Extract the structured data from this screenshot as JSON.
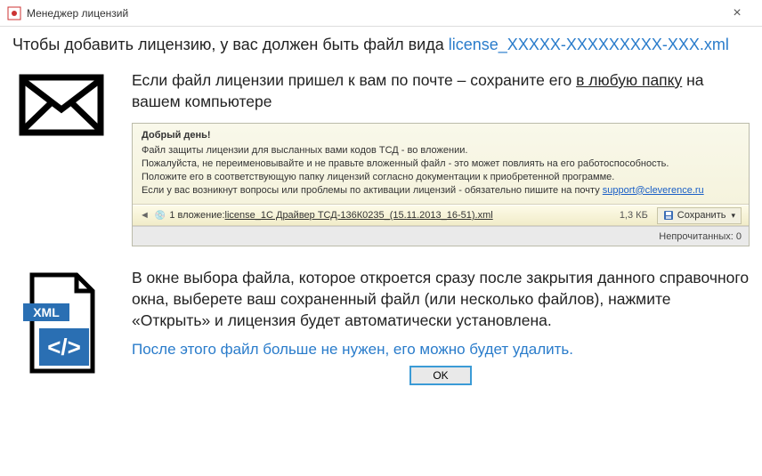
{
  "window": {
    "title": "Менеджер лицензий"
  },
  "header": {
    "prefix": "Чтобы добавить лицензию, у вас должен быть файл вида ",
    "filename": "license_XXXXX-XXXXXXXXX-XXX.xml"
  },
  "section1": {
    "line_pre": "Если файл лицензии пришел к вам по почте – сохраните его ",
    "link": "в любую папку",
    "line_post": " на вашем компьютере"
  },
  "email": {
    "greet": "Добрый день!",
    "l1": "Файл защиты лицензии для высланных вами кодов ТСД - во вложении.",
    "l2": "Пожалуйста, не переименовывайте и не правьте вложенный файл - это может повлиять на его работоспособность.",
    "l3": "Положите его в соответствующую папку лицензий согласно документации к приобретенной программе.",
    "l4_pre": "Если у вас возникнут вопросы или проблемы по активации лицензий - обязательно пишите на почту ",
    "l4_link": "support@cleverence.ru",
    "attachment_label": "1 вложение: ",
    "attachment_name": "license_1С Драйвер ТСД-136К0235_(15.11.2013_16-51).xml",
    "attachment_size": "1,3 КБ",
    "save_label": "Сохранить",
    "status": "Непрочитанных: 0"
  },
  "section2": {
    "paragraph": "В окне выбора файла, которое откроется сразу после закрытия данного справочного окна, выберете ваш сохраненный файл (или несколько файлов), нажмите «Открыть» и лицензия будет автоматически установлена.",
    "afternote": "После этого файл больше не нужен, его можно будет удалить."
  },
  "buttons": {
    "ok": "OK"
  }
}
